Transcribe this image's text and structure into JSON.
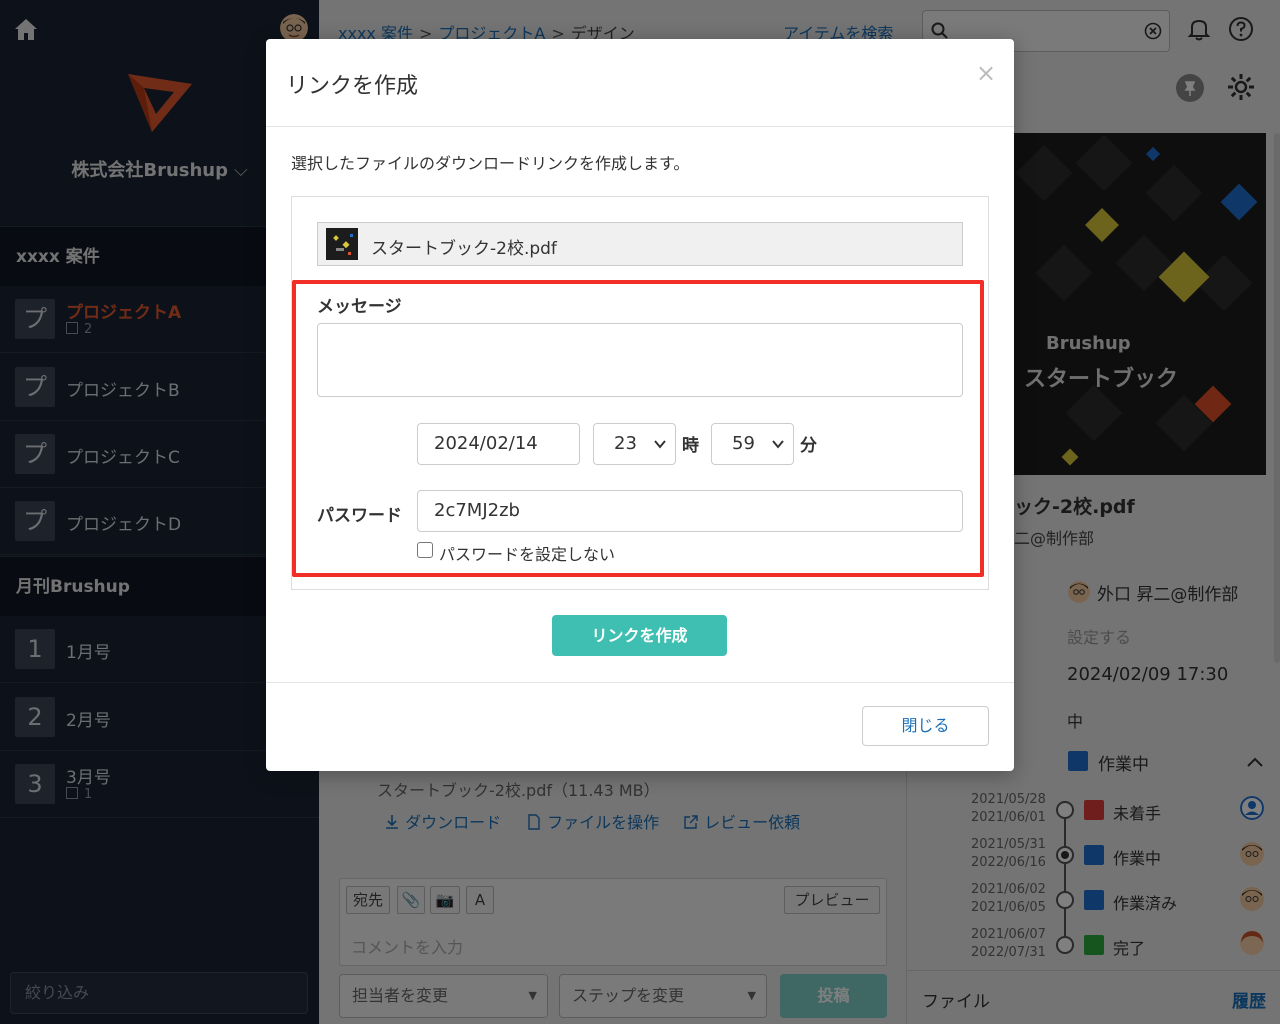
{
  "sidebar": {
    "company": "株式会社Brushup",
    "sections": [
      {
        "title": "xxxx 案件",
        "items": [
          {
            "badge": "プ",
            "label": "プロジェクトA",
            "count": "2",
            "active": true
          },
          {
            "badge": "プ",
            "label": "プロジェクトB"
          },
          {
            "badge": "プ",
            "label": "プロジェクトC"
          },
          {
            "badge": "プ",
            "label": "プロジェクトD"
          }
        ]
      },
      {
        "title": "月刊Brushup",
        "items": [
          {
            "badge": "1",
            "label": "1月号"
          },
          {
            "badge": "2",
            "label": "2月号"
          },
          {
            "badge": "3",
            "label": "3月号",
            "count": "1"
          }
        ]
      }
    ],
    "filter_placeholder": "絞り込み"
  },
  "header": {
    "breadcrumb": [
      "xxxx 案件",
      "プロジェクトA",
      "デザイン"
    ],
    "breadcrumb_sep": ">",
    "search_link": "アイテムを検索"
  },
  "main": {
    "file_line": "スタートブック-2校.pdf（11.43 MB）",
    "actions": [
      "ダウンロード",
      "ファイルを操作",
      "レビュー依頼"
    ],
    "comment_buttons": [
      "宛先",
      "A"
    ],
    "preview_button": "プレビュー",
    "comment_placeholder": "コメントを入力",
    "assignee_select": "担当者を変更",
    "step_select": "ステップを変更",
    "post_button": "投稿"
  },
  "right": {
    "thumb_brand": "Brushup",
    "thumb_title": "スタートブック",
    "filename": "ック-2校.pdf",
    "owner": "二@制作部",
    "assignee": "外口 昇二@制作部",
    "set_link": "設定する",
    "deadline": "2024/02/09 17:30",
    "priority": "中",
    "status": "作業中",
    "steps": [
      {
        "dates": [
          "2021/05/28",
          "2021/06/01"
        ],
        "label": "未着手",
        "color": "#e03a3a",
        "selected": false
      },
      {
        "dates": [
          "2021/05/31",
          "2022/06/16"
        ],
        "label": "作業中",
        "color": "#1f6fd0",
        "selected": true
      },
      {
        "dates": [
          "2021/06/02",
          "2021/06/05"
        ],
        "label": "作業済み",
        "color": "#1f6fd0",
        "selected": false
      },
      {
        "dates": [
          "2021/06/07",
          "2022/07/31"
        ],
        "label": "完了",
        "color": "#2eab3f",
        "selected": false
      }
    ],
    "files_tab": "ファイル",
    "history_tab": "履歴"
  },
  "modal": {
    "title": "リンクを作成",
    "close_glyph": "×",
    "description": "選択したファイルのダウンロードリンクを作成します。",
    "file_name": "スタートブック-2校.pdf",
    "message_label": "メッセージ",
    "message_value": "",
    "expiry_date": "2024/02/14",
    "hour": "23",
    "hour_unit": "時",
    "minute": "59",
    "minute_unit": "分",
    "password_label": "パスワード",
    "password_value": "2c7MJ2zb",
    "no_password_label": "パスワードを設定しない",
    "create_button": "リンクを作成",
    "close_button": "閉じる"
  },
  "colors": {
    "sidebar_bg": "#1b2434",
    "accent_orange": "#e2592e",
    "teal_button": "#3fbfb1",
    "highlight_red": "#f22f27",
    "link_blue": "#1a6fb8"
  }
}
